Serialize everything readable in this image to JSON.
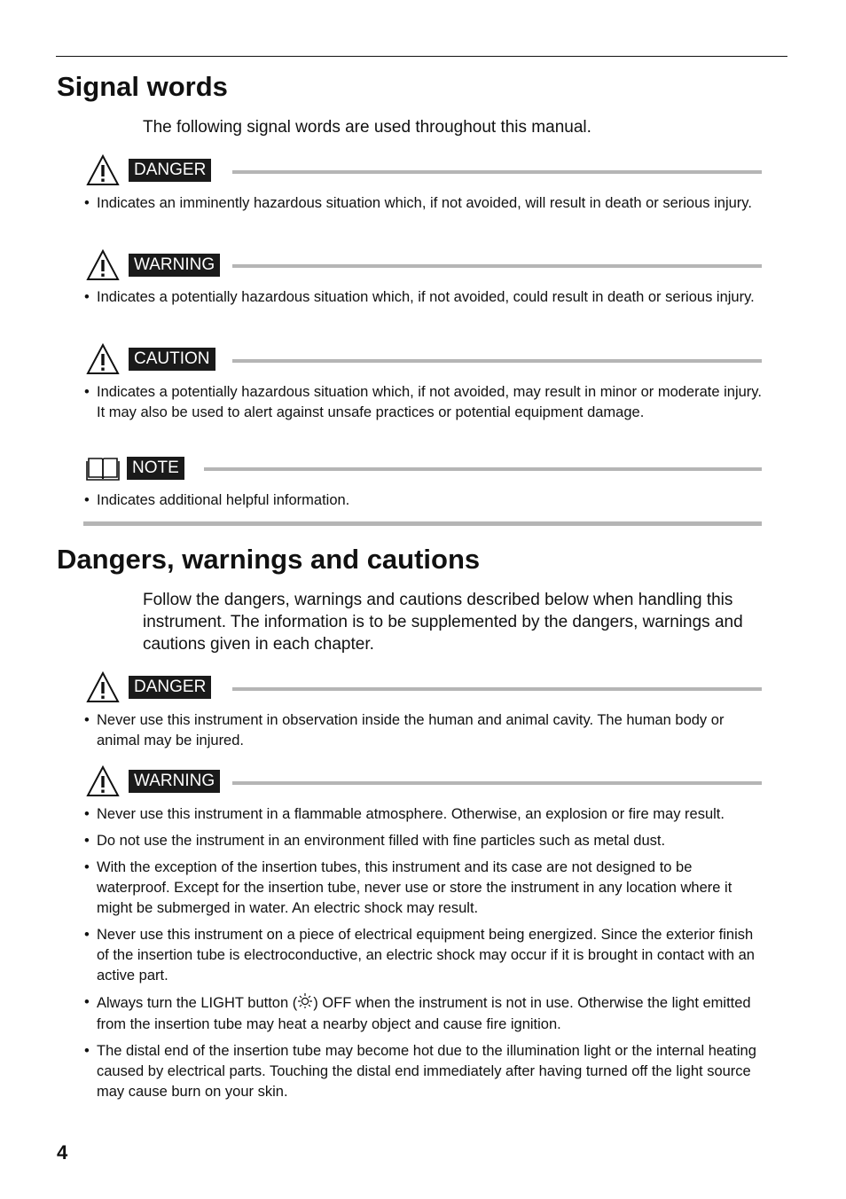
{
  "sections": [
    {
      "title": "Signal words",
      "intro": "The following signal words are used throughout this manual.",
      "signals": [
        {
          "icon": "warning-triangle-icon",
          "label": "DANGER",
          "bullets": [
            "Indicates an imminently hazardous situation which, if not avoided, will result in death or serious injury."
          ]
        },
        {
          "icon": "warning-triangle-icon",
          "label": "WARNING",
          "bullets": [
            "Indicates a potentially hazardous situation which, if not avoided, could result in death or serious injury."
          ]
        },
        {
          "icon": "warning-triangle-icon",
          "label": "CAUTION",
          "bullets": [
            "Indicates a potentially hazardous situation which, if not avoided, may result in minor or moderate injury. It may also be used to alert against unsafe practices or potential equipment damage."
          ]
        },
        {
          "icon": "open-book-icon",
          "label": "NOTE",
          "bullets": [
            "Indicates additional helpful information."
          ]
        }
      ]
    },
    {
      "title": "Dangers, warnings and cautions",
      "intro": "Follow the dangers, warnings and cautions described below when handling this instrument. The information is to be supplemented by the dangers, warnings and cautions given in each chapter.",
      "signals": [
        {
          "icon": "warning-triangle-icon",
          "label": "DANGER",
          "bullets": [
            "Never use this instrument in observation inside the human and animal cavity. The human body or animal may be injured."
          ]
        },
        {
          "icon": "warning-triangle-icon",
          "label": "WARNING",
          "bullets": [
            "Never use this instrument in a flammable atmosphere. Otherwise, an explosion or fire may result.",
            "Do not use the instrument in an environment filled with fine particles such as metal dust.",
            "With the exception of the insertion tubes, this instrument and its case are not designed to be waterproof. Except for the insertion tube, never use or store the instrument in any location where it might be submerged in water. An electric shock may result.",
            "Never use this instrument on a piece of electrical equipment being energized. Since the exterior finish of the insertion tube is electroconductive, an electric shock may occur if it is brought in contact with an active part.",
            {
              "before": "Always turn the LIGHT button (",
              "icon": "light-sun-icon",
              "after": ") OFF when the instrument is not in use. Otherwise the light emitted from the insertion tube may heat a nearby object and cause fire ignition."
            },
            "The distal end of the insertion tube may become hot due to the illumination light or the internal heating caused by electrical parts. Touching the distal end immediately after having turned off the light source may cause burn on your skin."
          ]
        }
      ]
    }
  ],
  "page_number": "4"
}
